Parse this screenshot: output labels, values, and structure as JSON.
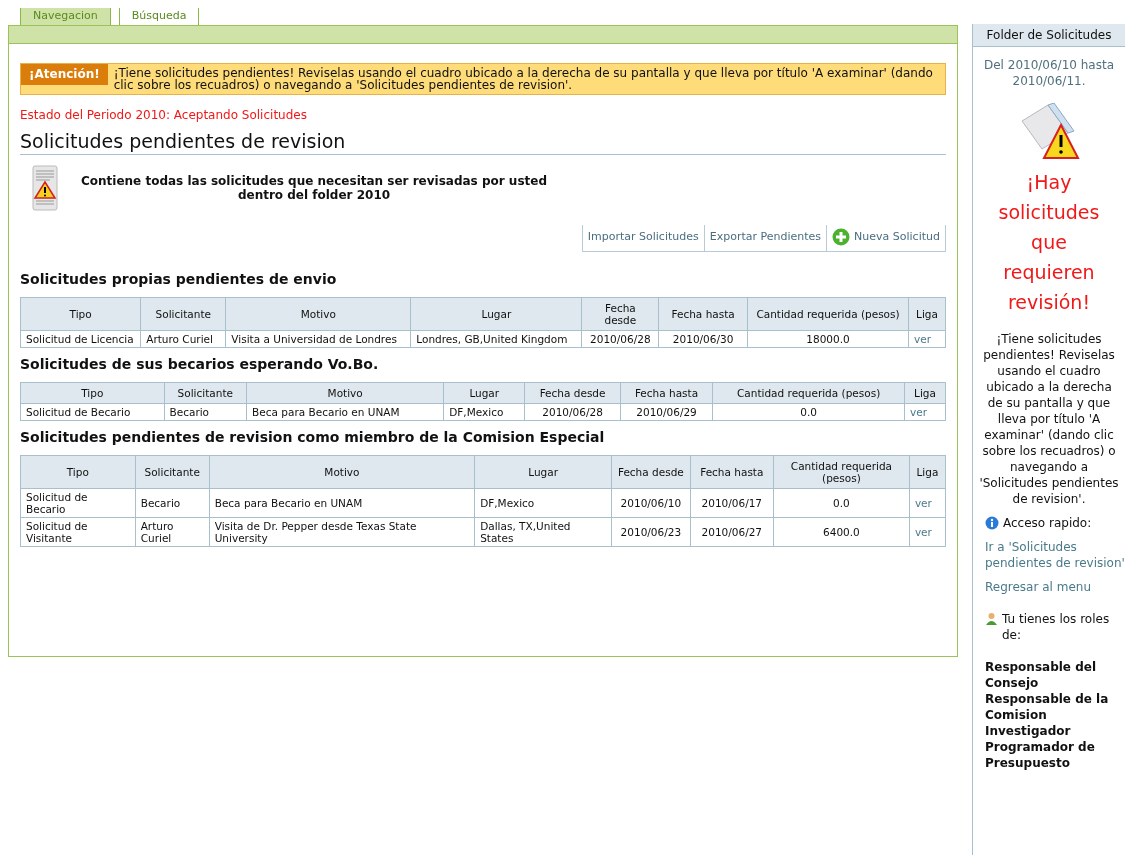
{
  "tabs": [
    {
      "label": "Navegacion",
      "selected": true
    },
    {
      "label": "Búsqueda",
      "selected": false
    }
  ],
  "alert": {
    "badge": "¡Atención!",
    "text": "¡Tiene solicitudes pendientes! Reviselas usando el cuadro ubicado a la derecha de su pantalla y que lleva por título 'A examinar' (dando clic sobre los recuadros) o navegando a 'Solicitudes pendientes de revision'."
  },
  "period_status": "Estado del Periodo 2010: Aceptando Solicitudes",
  "page_title": "Solicitudes pendientes de revision",
  "description": "Contiene todas las solicitudes que necesitan ser revisadas por usted dentro del folder 2010",
  "actions": [
    {
      "label": "Importar Solicitudes",
      "kind": "plain"
    },
    {
      "label": "Exportar Pendientes",
      "kind": "plain"
    },
    {
      "label": "Nueva Solicitud",
      "kind": "add"
    }
  ],
  "sections": [
    {
      "title": "Solicitudes propias pendientes de envio",
      "columns": [
        "Tipo",
        "Solicitante",
        "Motivo",
        "Lugar",
        "Fecha desde",
        "Fecha hasta",
        "Cantidad requerida (pesos)",
        "Liga"
      ],
      "rows": [
        [
          "Solicitud de Licencia",
          "Arturo Curiel",
          "Visita a Universidad de Londres",
          "Londres, GB,United Kingdom",
          "2010/06/28",
          "2010/06/30",
          "18000.0",
          "ver"
        ]
      ]
    },
    {
      "title": "Solicitudes de sus becarios esperando Vo.Bo.",
      "columns": [
        "Tipo",
        "Solicitante",
        "Motivo",
        "Lugar",
        "Fecha desde",
        "Fecha hasta",
        "Cantidad requerida (pesos)",
        "Liga"
      ],
      "rows": [
        [
          "Solicitud de Becario",
          "Becario",
          "Beca para Becario en UNAM",
          "DF,Mexico",
          "2010/06/28",
          "2010/06/29",
          "0.0",
          "ver"
        ]
      ]
    },
    {
      "title": "Solicitudes pendientes de revision como miembro de la Comision Especial",
      "columns": [
        "Tipo",
        "Solicitante",
        "Motivo",
        "Lugar",
        "Fecha desde",
        "Fecha hasta",
        "Cantidad requerida (pesos)",
        "Liga"
      ],
      "rows": [
        [
          "Solicitud de Becario",
          "Becario",
          "Beca para Becario en UNAM",
          "DF,Mexico",
          "2010/06/10",
          "2010/06/17",
          "0.0",
          "ver"
        ],
        [
          "Solicitud de Visitante",
          "Arturo Curiel",
          "Visita de Dr. Pepper desde Texas State University",
          "Dallas, TX,United States",
          "2010/06/23",
          "2010/06/27",
          "6400.0",
          "ver"
        ]
      ]
    }
  ],
  "sidebar": {
    "title": "Folder de Solicitudes",
    "date_range": "Del 2010/06/10 hasta 2010/06/11.",
    "warning": "¡Hay solicitudes que requieren revisión!",
    "message": "¡Tiene solicitudes pendientes! Reviselas usando el cuadro ubicado a la derecha de su pantalla y que lleva por título 'A examinar' (dando clic sobre los recuadros) o navegando a 'Solicitudes pendientes de revision'.",
    "quick_access_label": "Acceso rapido:",
    "links": [
      "Ir a 'Solicitudes pendientes de revision'",
      "Regresar al menu"
    ],
    "roles_label": "Tu tienes los roles de:",
    "roles": [
      "Responsable del Consejo",
      "Responsable de la Comision",
      "Investigador",
      "Programador de Presupuesto"
    ]
  }
}
